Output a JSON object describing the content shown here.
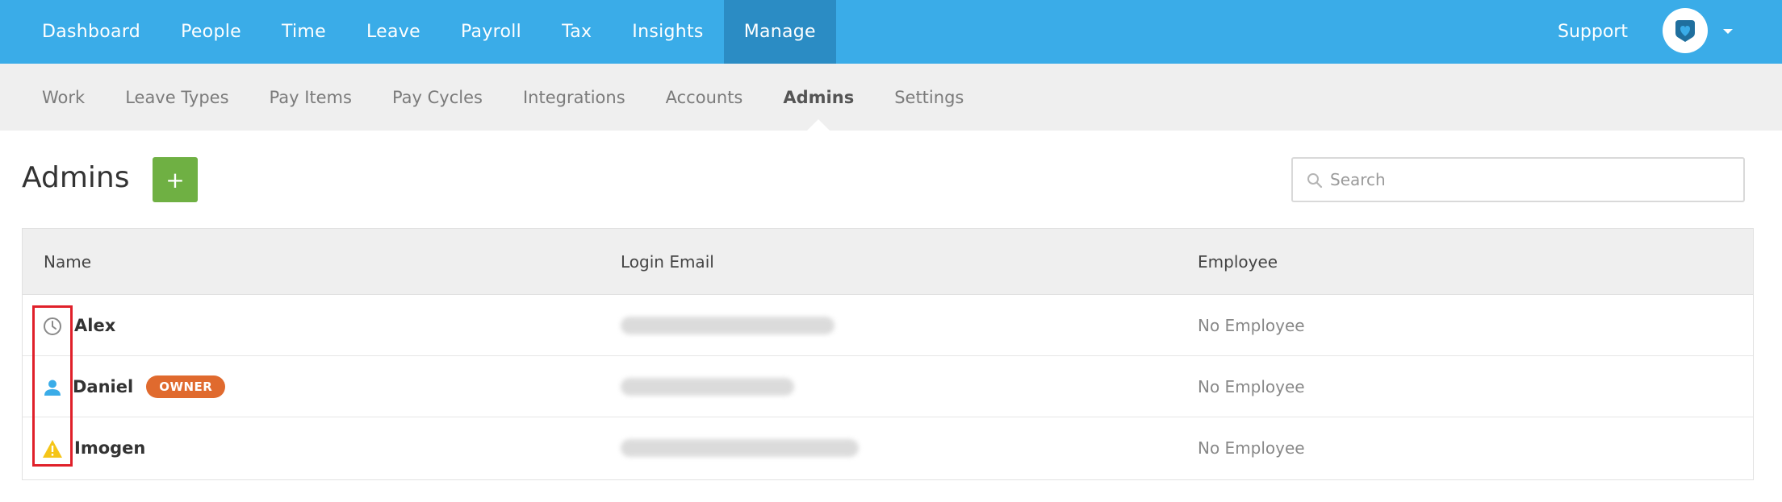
{
  "topnav": {
    "items": [
      {
        "label": "Dashboard",
        "active": false
      },
      {
        "label": "People",
        "active": false
      },
      {
        "label": "Time",
        "active": false
      },
      {
        "label": "Leave",
        "active": false
      },
      {
        "label": "Payroll",
        "active": false
      },
      {
        "label": "Tax",
        "active": false
      },
      {
        "label": "Insights",
        "active": false
      },
      {
        "label": "Manage",
        "active": true
      }
    ],
    "support_label": "Support",
    "avatar_icon": "company-logo-icon",
    "menu_icon": "chevron-down-icon"
  },
  "subnav": {
    "items": [
      {
        "label": "Work",
        "active": false
      },
      {
        "label": "Leave Types",
        "active": false
      },
      {
        "label": "Pay Items",
        "active": false
      },
      {
        "label": "Pay Cycles",
        "active": false
      },
      {
        "label": "Integrations",
        "active": false
      },
      {
        "label": "Accounts",
        "active": false
      },
      {
        "label": "Admins",
        "active": true
      },
      {
        "label": "Settings",
        "active": false
      }
    ]
  },
  "page": {
    "title": "Admins",
    "add_label": "+",
    "search_placeholder": "Search",
    "search_value": ""
  },
  "table": {
    "columns": [
      "Name",
      "Login Email",
      "Employee"
    ],
    "rows": [
      {
        "icon": "clock-icon",
        "name": "Alex",
        "badge": "",
        "email": "",
        "employee": "No Employee"
      },
      {
        "icon": "person-icon",
        "name": "Daniel",
        "badge": "OWNER",
        "email": "",
        "employee": "No Employee"
      },
      {
        "icon": "warning-icon",
        "name": "Imogen",
        "badge": "",
        "email": "",
        "employee": "No Employee"
      }
    ]
  },
  "colors": {
    "primary_nav": "#3aace8",
    "primary_nav_active": "#2b8cc4",
    "add_button": "#6fb043",
    "owner_badge": "#e06a2e",
    "warning": "#f5c518",
    "highlight": "#e0202a"
  }
}
